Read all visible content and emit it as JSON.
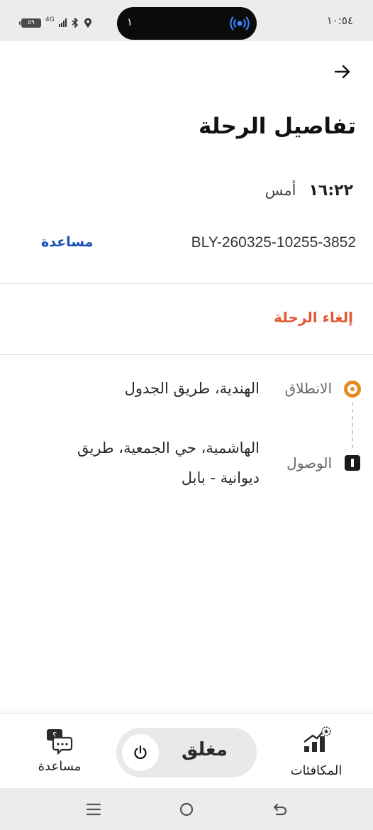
{
  "status_bar": {
    "time": "١٠:٥٤",
    "pill_count": "١",
    "battery": "٥٩",
    "network": "4G"
  },
  "header": {
    "title": "تفاصيل الرحلة",
    "back_icon": "arrow-right-icon"
  },
  "trip": {
    "time": "١٦:٢٢",
    "day": "أمس",
    "id": "BLY-260325-10255-3852",
    "help_label": "مساعدة",
    "cancel_label": "إلغاء الرحلة"
  },
  "route": {
    "start_label": "الانطلاق",
    "start_address": "الهندية، طريق الجدول",
    "end_label": "الوصول",
    "end_address": "الهاشمية، حي الجمعية، طريق ديوانية - بابل"
  },
  "bottom_nav": {
    "help_label": "مساعدة",
    "toggle_label": "مغلق",
    "rewards_label": "المكافئات"
  },
  "colors": {
    "accent_link": "#1a4fb5",
    "cancel": "#e05a33",
    "start_dot": "#e58a1f"
  }
}
